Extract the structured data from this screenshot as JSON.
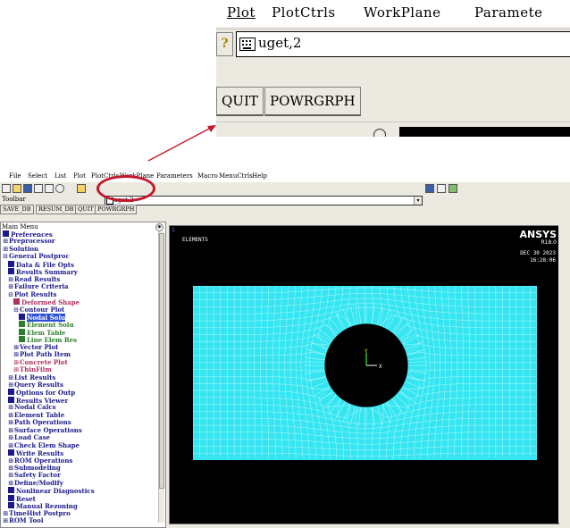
{
  "zoom": {
    "menu": [
      "Plot",
      "PlotCtrls",
      "WorkPlane",
      "Paramete"
    ],
    "command_value": "uget,2",
    "buttons": [
      "QUIT",
      "POWRGRPH"
    ]
  },
  "window": {
    "menu": [
      "File",
      "Select",
      "List",
      "Plot",
      "PlotCtrls",
      "WorkPlane",
      "Parameters",
      "Macro",
      "MenuCtrls",
      "Help"
    ],
    "command_value": "uget,2",
    "toolbar_label": "Toolbar",
    "toolbar_buttons": [
      "SAVE_DB",
      "RESUM_DB",
      "QUIT",
      "POWRGRPH"
    ],
    "main_menu_title": "Main Menu",
    "tree": [
      {
        "text": "Preferences",
        "level": 0,
        "mark": "box",
        "color": "blue"
      },
      {
        "text": "Preprocessor",
        "level": 0,
        "mark": "plus",
        "color": "blue"
      },
      {
        "text": "Solution",
        "level": 0,
        "mark": "plus",
        "color": "blue"
      },
      {
        "text": "General Postproc",
        "level": 0,
        "mark": "minus",
        "color": "blue"
      },
      {
        "text": "Data & File Opts",
        "level": 1,
        "mark": "box",
        "color": "blue"
      },
      {
        "text": "Results Summary",
        "level": 1,
        "mark": "box",
        "color": "blue"
      },
      {
        "text": "Read Results",
        "level": 1,
        "mark": "plus",
        "color": "blue"
      },
      {
        "text": "Failure Criteria",
        "level": 1,
        "mark": "plus",
        "color": "blue"
      },
      {
        "text": "Plot Results",
        "level": 1,
        "mark": "minus",
        "color": "blue"
      },
      {
        "text": "Deformed Shape",
        "level": 2,
        "mark": "box",
        "color": "pink"
      },
      {
        "text": "Contour Plot",
        "level": 2,
        "mark": "minus",
        "color": "blue"
      },
      {
        "text": "Nodal Solu",
        "level": 3,
        "mark": "box",
        "color": "sel"
      },
      {
        "text": "Element Solu",
        "level": 3,
        "mark": "box",
        "color": "green"
      },
      {
        "text": "Elem Table",
        "level": 3,
        "mark": "box",
        "color": "green"
      },
      {
        "text": "Line Elem Res",
        "level": 3,
        "mark": "box",
        "color": "green"
      },
      {
        "text": "Vector Plot",
        "level": 2,
        "mark": "plus",
        "color": "blue"
      },
      {
        "text": "Plot Path Item",
        "level": 2,
        "mark": "plus",
        "color": "blue"
      },
      {
        "text": "Concrete Plot",
        "level": 2,
        "mark": "plus",
        "color": "pink"
      },
      {
        "text": "ThinFilm",
        "level": 2,
        "mark": "plus",
        "color": "pink"
      },
      {
        "text": "List Results",
        "level": 1,
        "mark": "plus",
        "color": "blue"
      },
      {
        "text": "Query Results",
        "level": 1,
        "mark": "plus",
        "color": "blue"
      },
      {
        "text": "Options for Outp",
        "level": 1,
        "mark": "box",
        "color": "blue"
      },
      {
        "text": "Results Viewer",
        "level": 1,
        "mark": "box",
        "color": "blue"
      },
      {
        "text": "Nodal Calcs",
        "level": 1,
        "mark": "plus",
        "color": "blue"
      },
      {
        "text": "Element Table",
        "level": 1,
        "mark": "plus",
        "color": "blue"
      },
      {
        "text": "Path Operations",
        "level": 1,
        "mark": "plus",
        "color": "blue"
      },
      {
        "text": "Surface Operations",
        "level": 1,
        "mark": "plus",
        "color": "blue"
      },
      {
        "text": "Load Case",
        "level": 1,
        "mark": "plus",
        "color": "blue"
      },
      {
        "text": "Check Elem Shape",
        "level": 1,
        "mark": "plus",
        "color": "blue"
      },
      {
        "text": "Write Results",
        "level": 1,
        "mark": "box",
        "color": "blue"
      },
      {
        "text": "ROM Operations",
        "level": 1,
        "mark": "plus",
        "color": "blue"
      },
      {
        "text": "Submodeling",
        "level": 1,
        "mark": "plus",
        "color": "blue"
      },
      {
        "text": "Safety Factor",
        "level": 1,
        "mark": "plus",
        "color": "blue"
      },
      {
        "text": "Define/Modify",
        "level": 1,
        "mark": "plus",
        "color": "blue"
      },
      {
        "text": "Nonlinear Diagnostics",
        "level": 1,
        "mark": "box",
        "color": "blue"
      },
      {
        "text": "Reset",
        "level": 1,
        "mark": "box",
        "color": "blue"
      },
      {
        "text": "Manual Rezoning",
        "level": 1,
        "mark": "box",
        "color": "blue"
      },
      {
        "text": "TimeHist Postpro",
        "level": 0,
        "mark": "plus",
        "color": "blue"
      },
      {
        "text": "ROM Tool",
        "level": 0,
        "mark": "plus",
        "color": "blue"
      }
    ],
    "graphics": {
      "window_number": "1",
      "plot_label": "ELEMENTS",
      "brand": "ANSYS",
      "release": "R18.0",
      "date": "DEC 30 2023",
      "time": "16:28:06",
      "axis_y": "Y",
      "axis_x": "X",
      "mesh_color": "#35e6f2",
      "background_color": "#000000"
    }
  }
}
